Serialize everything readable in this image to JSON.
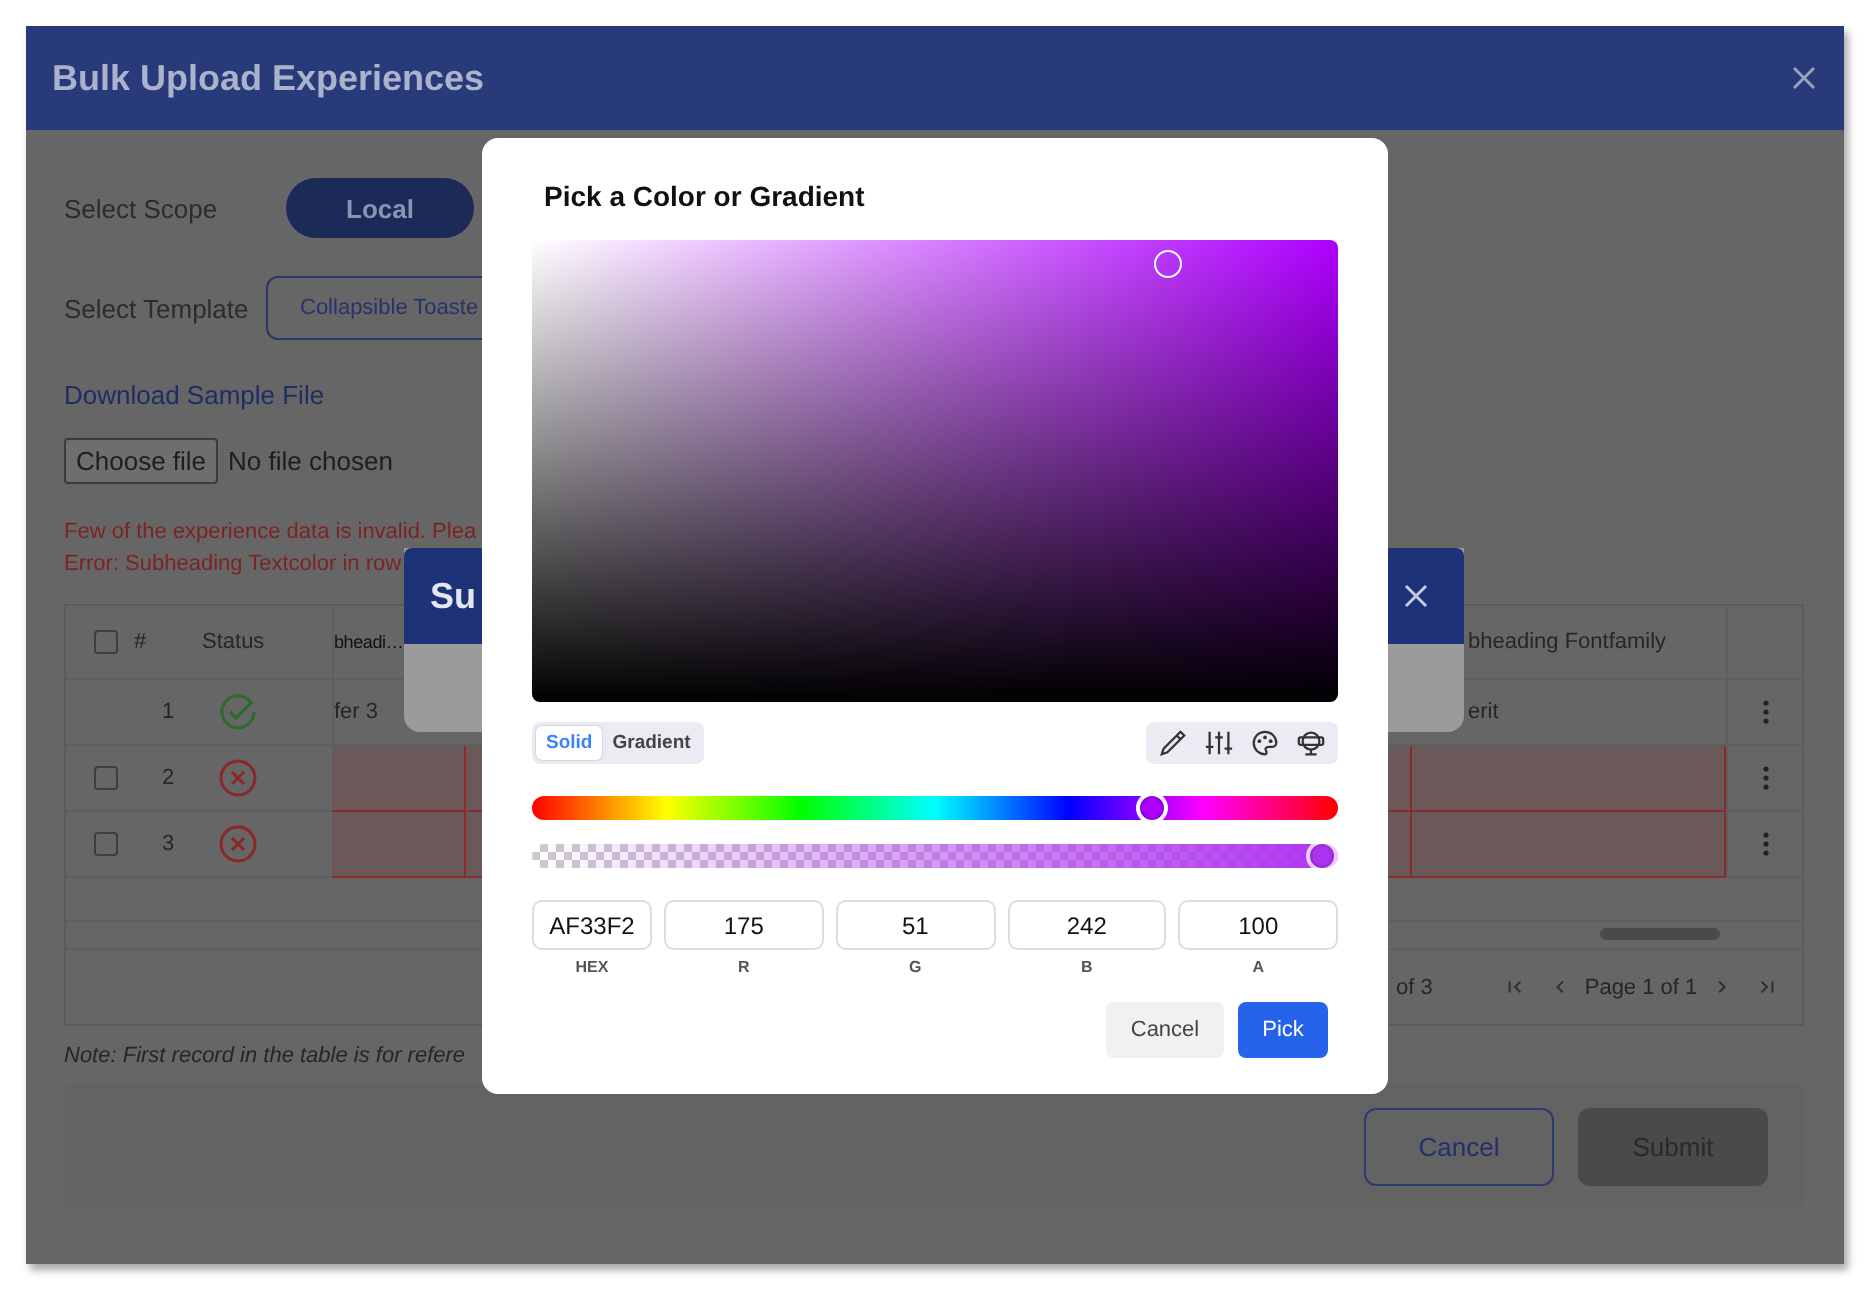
{
  "window": {
    "title": "Bulk Upload Experiences"
  },
  "form": {
    "scope_label": "Select Scope",
    "scope_options": [
      {
        "label": "Local",
        "selected": true
      }
    ],
    "template_label": "Select Template",
    "template_value": "Collapsible Toaste",
    "download_link": "Download Sample File",
    "file_button": "Choose file",
    "file_status": "No file chosen",
    "errors": [
      "Few of the experience data is invalid. Plea",
      "Error: Subheading Textcolor in row"
    ]
  },
  "table": {
    "header_checked": false,
    "columns": [
      "#",
      "Status",
      "bheadi…",
      "bheading Fontfamily"
    ],
    "rows": [
      {
        "number": "1",
        "valid": true,
        "cell_1": "fer 3",
        "cell_2": "erit"
      },
      {
        "number": "2",
        "valid": false,
        "checked": false
      },
      {
        "number": "3",
        "valid": false,
        "checked": false
      }
    ],
    "pagination": {
      "range": "of 3",
      "page": "Page 1 of 1"
    }
  },
  "note": "Note: First record in the table is for refere",
  "buttons": [
    {
      "label": "Cancel",
      "kind": "secondary"
    },
    {
      "label": "Submit",
      "kind": "primary"
    }
  ],
  "middle_dialog": {
    "title": "Su"
  },
  "color_picker": {
    "title": "Pick a Color or Gradient",
    "modes": [
      {
        "label": "Solid",
        "selected": true
      },
      {
        "label": "Gradient",
        "selected": false
      }
    ],
    "hue": {
      "level": 0.78
    },
    "alpha": {
      "level": 1
    },
    "fields": [
      {
        "label": "HEX",
        "value": "AF33F2"
      },
      {
        "label": "R",
        "value": "175"
      },
      {
        "label": "G",
        "value": "51"
      },
      {
        "label": "B",
        "value": "242"
      },
      {
        "label": "A",
        "value": "100"
      }
    ],
    "buttons": [
      {
        "label": "Cancel",
        "kind": "secondary"
      },
      {
        "label": "Pick",
        "kind": "primary"
      }
    ]
  }
}
